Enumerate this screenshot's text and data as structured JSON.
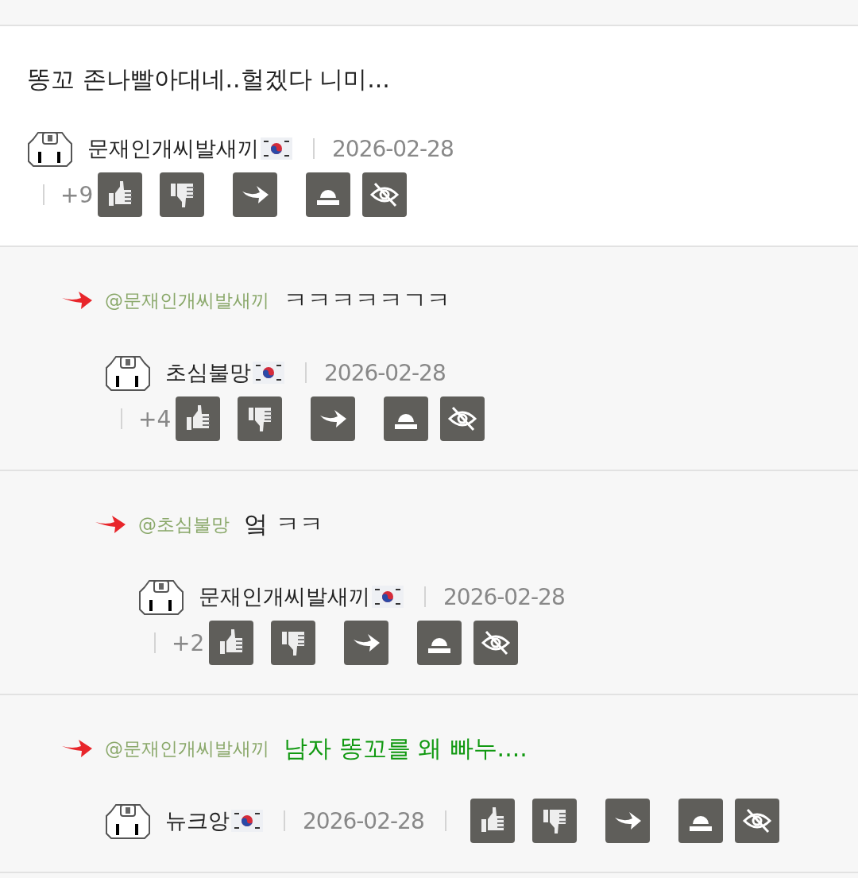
{
  "comments": [
    {
      "text": "똥꼬 존나빨아대네..헐겠다 니미...",
      "color": "#222222",
      "author": "문재인개씨발새끼",
      "date": "2026-02-28",
      "score": "+9",
      "children": [
        {
          "mention": "@문재인개씨발새끼",
          "text": "ㅋㅋㅋㅋㅋㄱㅋ",
          "color": "#222222",
          "author": "초심불망",
          "date": "2026-02-28",
          "score": "+4",
          "children": [
            {
              "mention": "@초심불망",
              "text": "엌 ㅋㅋ",
              "color": "#222222",
              "author": "문재인개씨발새끼",
              "date": "2026-02-28",
              "score": "+2"
            }
          ]
        },
        {
          "mention": "@문재인개씨발새끼",
          "text": "남자 똥꼬를 왜 빠누....",
          "color": "#119911",
          "author": "뉴크앙",
          "date": "2026-02-28"
        }
      ]
    }
  ]
}
